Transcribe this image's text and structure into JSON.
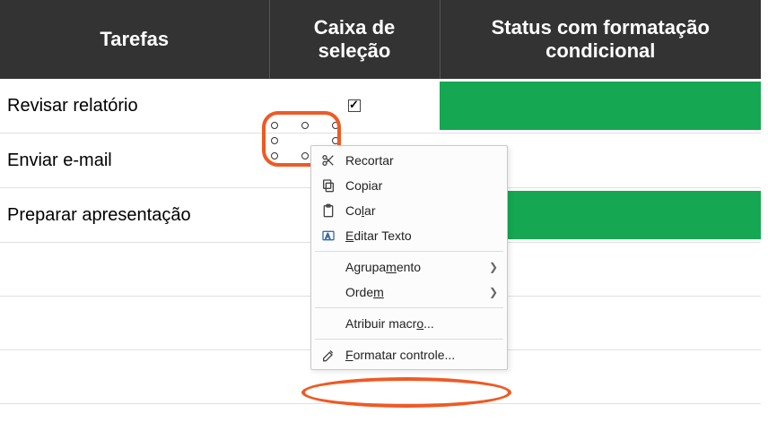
{
  "headers": {
    "tasks": "Tarefas",
    "checkbox": "Caixa de seleção",
    "status": "Status com formatação condicional"
  },
  "rows": [
    {
      "task": "Revisar relatório",
      "checked": true,
      "status_color": "green"
    },
    {
      "task": "Enviar e-mail",
      "checked": false,
      "status_color": "white"
    },
    {
      "task": "Preparar apresentação",
      "checked": true,
      "status_color": "green"
    }
  ],
  "context_menu": {
    "cut": "Recortar",
    "copy": "Copiar",
    "paste": "Colar",
    "edit_text": "Editar Texto",
    "grouping": "Agrupamento",
    "order": "Ordem",
    "assign_macro": "Atribuir macro...",
    "format_control": "Formatar controle..."
  },
  "highlights": {
    "primary": "#ee5a24"
  }
}
